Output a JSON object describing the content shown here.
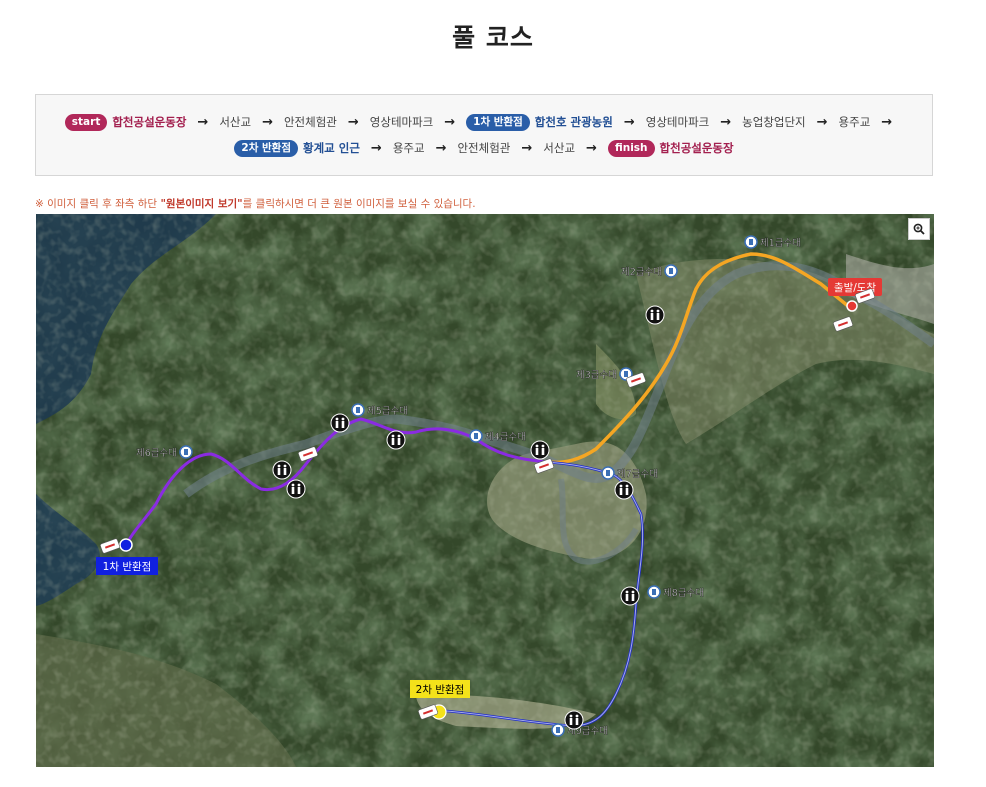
{
  "page": {
    "title": "풀 코스"
  },
  "route": {
    "line1": [
      {
        "type": "badge",
        "badge": "start",
        "text": "합천공설운동장",
        "color": "red"
      },
      {
        "type": "plain",
        "text": "서산교"
      },
      {
        "type": "plain",
        "text": "안전체험관"
      },
      {
        "type": "plain",
        "text": "영상테마파크"
      },
      {
        "type": "badge",
        "badge": "1차 반환점",
        "text": "합천호 관광농원",
        "color": "blue"
      },
      {
        "type": "plain",
        "text": "영상테마파크"
      },
      {
        "type": "plain",
        "text": "농업창업단지"
      },
      {
        "type": "plain",
        "text": "용주교"
      }
    ],
    "line2": [
      {
        "type": "badge",
        "badge": "2차 반환점",
        "text": "황계교 인근",
        "color": "blue"
      },
      {
        "type": "plain",
        "text": "용주교"
      },
      {
        "type": "plain",
        "text": "안전체험관"
      },
      {
        "type": "plain",
        "text": "서산교"
      },
      {
        "type": "badge",
        "badge": "finish",
        "text": "합천공설운동장",
        "color": "red"
      }
    ],
    "arrow": "→"
  },
  "notice": {
    "prefix": "※ 이미지 클릭 후 좌측 하단 ",
    "highlight": "\"원본이미지 보기\"",
    "suffix": "를 클릭하시면 더 큰 원본 이미지를 보실 수 있습니다."
  },
  "map": {
    "zoom_icon": "zoom-in-icon",
    "markers": {
      "start_finish": "출발/도착",
      "turn1": "1차 반환점",
      "turn2": "2차 반환점"
    },
    "water_stations": [
      {
        "label": "제1급수대"
      },
      {
        "label": "제2급수대"
      },
      {
        "label": "제3급수대"
      },
      {
        "label": "제4급수대"
      },
      {
        "label": "제5급수대"
      },
      {
        "label": "제6급수대"
      },
      {
        "label": "제7급수대"
      },
      {
        "label": "제8급수대"
      },
      {
        "label": "제9급수대"
      }
    ],
    "colors": {
      "route_orange": "#f5a623",
      "route_purple": "#8a2be2",
      "route_blue": "#1e2cc8",
      "start_marker": "#e53935",
      "turn1_marker": "#1020e0",
      "turn2_marker": "#f4e21a",
      "satellite_base": "#2c3b24"
    },
    "icons": {
      "toilet": "toilet-icon",
      "ambulance": "ambulance-icon",
      "water": "water-station-icon"
    }
  }
}
